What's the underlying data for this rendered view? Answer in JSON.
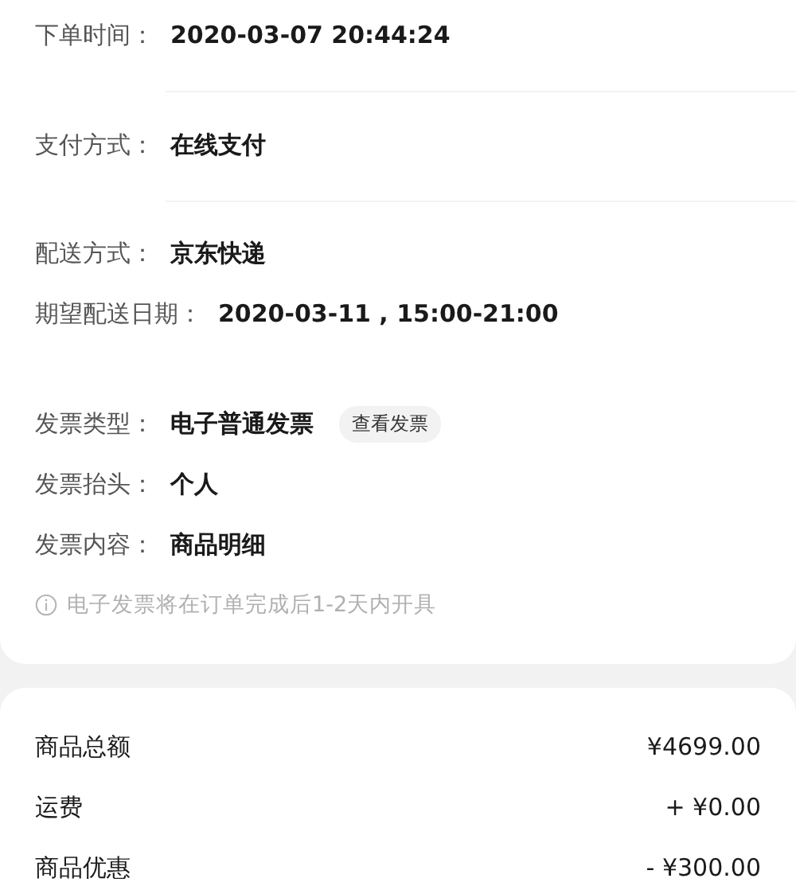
{
  "order_info": {
    "sections": [
      {
        "divider_after": true,
        "rows": [
          {
            "kind": "text",
            "label": "下单时间：",
            "value": "2020-03-07 20:44:24"
          }
        ]
      },
      {
        "divider_after": true,
        "rows": [
          {
            "kind": "text",
            "label": "支付方式：",
            "value": "在线支付"
          }
        ]
      },
      {
        "divider_after": false,
        "rows": [
          {
            "kind": "text",
            "label": "配送方式：",
            "value": "京东快递"
          },
          {
            "kind": "text",
            "label": "期望配送日期：",
            "value": "2020-03-11 , 15:00-21:00"
          }
        ]
      },
      {
        "divider_after": false,
        "rows": [
          {
            "kind": "invoice",
            "label": "发票类型：",
            "value": "电子普通发票",
            "button": "查看发票"
          },
          {
            "kind": "text",
            "label": "发票抬头：",
            "value": "个人"
          },
          {
            "kind": "text",
            "label": "发票内容：",
            "value": "商品明细"
          }
        ]
      }
    ],
    "note": "电子发票将在订单完成后1-2天内开具"
  },
  "price_summary": [
    {
      "label": "商品总额",
      "amount": "¥4699.00"
    },
    {
      "label": "运费",
      "amount": "+ ¥0.00"
    },
    {
      "label": "商品优惠",
      "amount": "- ¥300.00"
    }
  ]
}
